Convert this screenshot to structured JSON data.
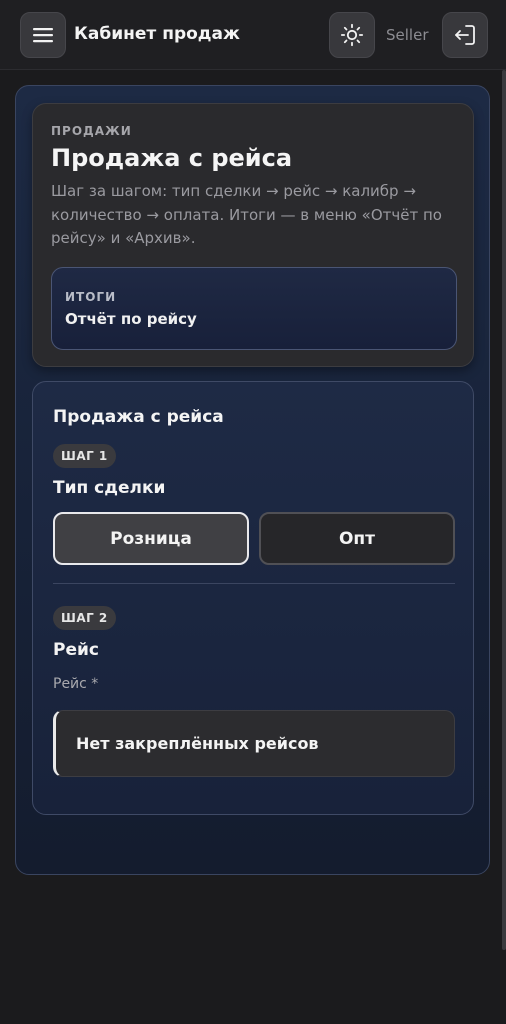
{
  "header": {
    "title": "Кабинет продаж",
    "user": "Seller",
    "icons": {
      "menu": "hamburger-icon",
      "theme": "sun-icon",
      "logout": "logout-icon"
    }
  },
  "hero": {
    "eyebrow": "ПРОДАЖИ",
    "title": "Продажа с рейса",
    "description": "Шаг за шагом: тип сделки → рейс → калибр → количество → оплата. Итоги — в меню «Отчёт по рейсу» и «Архив».",
    "summary": {
      "eyebrow": "ИТОГИ",
      "label": "Отчёт по рейсу"
    }
  },
  "form": {
    "title": "Продажа с рейса",
    "step1": {
      "badge": "ШАГ 1",
      "title": "Тип сделки",
      "options": [
        {
          "label": "Розница",
          "selected": true
        },
        {
          "label": "Опт",
          "selected": false
        }
      ]
    },
    "step2": {
      "badge": "ШАГ 2",
      "title": "Рейс",
      "field_label": "Рейс *",
      "field_value": "Нет закреплённых рейсов"
    }
  },
  "colors": {
    "background": "#1b1b1d",
    "accent_border": "#e9e9ec",
    "panel": "#1d2a44"
  }
}
